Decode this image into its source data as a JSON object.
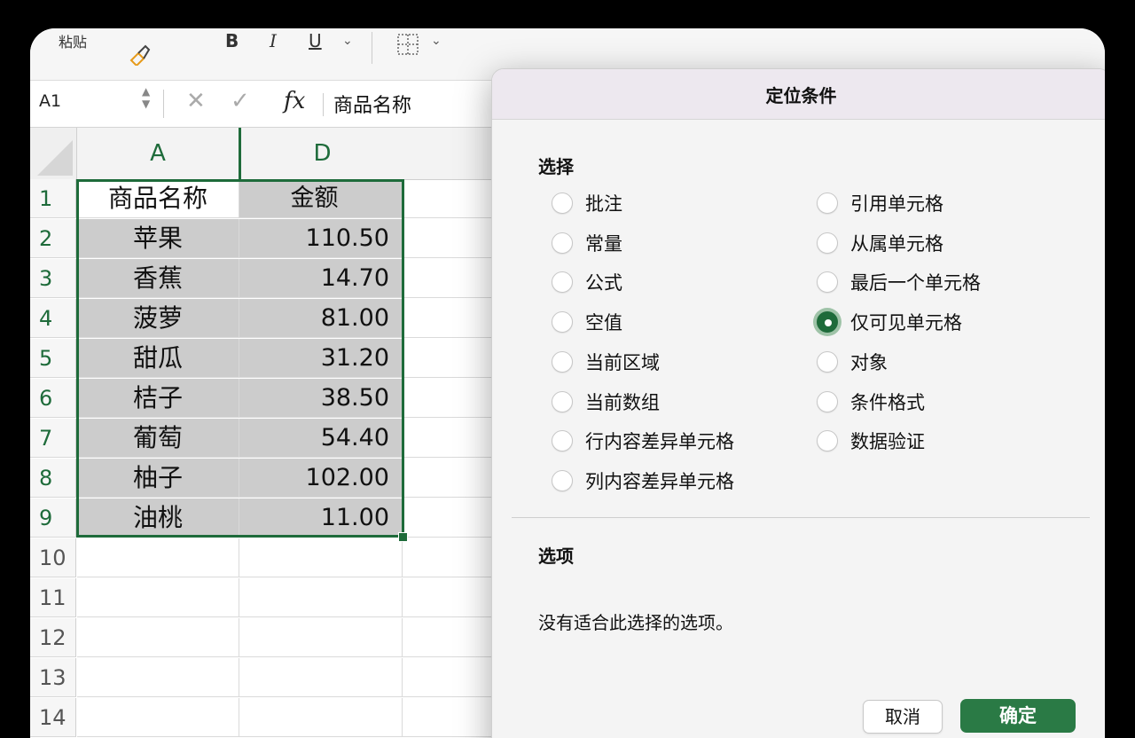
{
  "ribbon": {
    "paste_label": "粘贴",
    "bold": "B",
    "italic": "I",
    "underline": "U",
    "dropdown": "⌄"
  },
  "formula_bar": {
    "name_box": "A1",
    "cancel_glyph": "✕",
    "enter_glyph": "✓",
    "fx": "fx",
    "content": "商品名称"
  },
  "sheet": {
    "columns": [
      "A",
      "D"
    ],
    "row_numbers": [
      "1",
      "2",
      "3",
      "4",
      "5",
      "6",
      "7",
      "8",
      "9",
      "10",
      "11",
      "12",
      "13",
      "14"
    ],
    "rows": [
      {
        "a": "商品名称",
        "d": "金额"
      },
      {
        "a": "苹果",
        "d": "110.50"
      },
      {
        "a": "香蕉",
        "d": "14.70"
      },
      {
        "a": "菠萝",
        "d": "81.00"
      },
      {
        "a": "甜瓜",
        "d": "31.20"
      },
      {
        "a": "桔子",
        "d": "38.50"
      },
      {
        "a": "葡萄",
        "d": "54.40"
      },
      {
        "a": "柚子",
        "d": "102.00"
      },
      {
        "a": "油桃",
        "d": "11.00"
      }
    ]
  },
  "dialog": {
    "title": "定位条件",
    "select_section": "选择",
    "left_options": [
      "批注",
      "常量",
      "公式",
      "空值",
      "当前区域",
      "当前数组",
      "行内容差异单元格",
      "列内容差异单元格"
    ],
    "right_options": [
      "引用单元格",
      "从属单元格",
      "最后一个单元格",
      "仅可见单元格",
      "对象",
      "条件格式",
      "数据验证"
    ],
    "selected_option": "仅可见单元格",
    "options_section": "选项",
    "options_text": "没有适合此选择的选项。",
    "cancel_label": "取消",
    "ok_label": "确定"
  },
  "colors": {
    "accent": "#1e6b3a",
    "ok_button": "#2a7a45",
    "annotation_arrow": "#e8231f"
  }
}
